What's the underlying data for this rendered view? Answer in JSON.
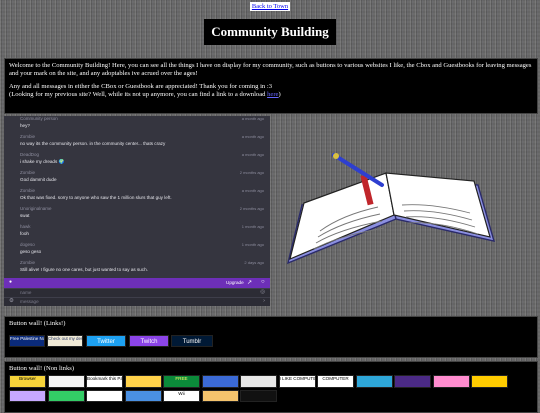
{
  "page": {
    "back_link": "Back to Town",
    "title": "Community Building",
    "welcome_p1": "Welcome to the Community Building! Here, you can see all the things I have on display for my community, such as buttons to various websites I like, the Cbox and Guestbooks for leaving messages and your mark on the site, and any adoptables ive acrued over the ages!",
    "welcome_p2_a": "Any and all messages in either the CBox or Guestbook are appreciated! Thank you for coming in :3",
    "welcome_p2_b": "(Looking for my previous site? Well, while its not up anymore, you can find a link to a download ",
    "welcome_link": "here",
    "welcome_p2_c": ")"
  },
  "chat": {
    "messages": [
      {
        "name": "Community person",
        "time": "a month ago",
        "text": "hey?"
      },
      {
        "name": "Zombie",
        "time": "a month ago",
        "text": "no way its the community person. in the community center... thats crazy"
      },
      {
        "name": "DeadDog",
        "time": "a month ago",
        "text": "i shake my dreads 🌍"
      },
      {
        "name": "Zombie",
        "time": "2 months ago",
        "text": "God dammit dude"
      },
      {
        "name": "Zombie",
        "time": "a month ago",
        "text": "Ok that was fixed. sorry to anyone who saw the 1 million slurs that guy left."
      },
      {
        "name": "Unoriginalname",
        "time": "2 months ago",
        "text": "swat"
      },
      {
        "name": "hawk",
        "time": "1 month ago",
        "text": "fooh"
      },
      {
        "name": "dogeso",
        "time": "1 month ago",
        "text": "geso geso"
      },
      {
        "name": "Zombie",
        "time": "2 days ago",
        "text": "Still alive! I figure no one cares, but just wanted to say as such."
      }
    ],
    "upgrade_label": "Upgrade",
    "name_placeholder": "name",
    "message_placeholder": "message"
  },
  "button_wall_links": {
    "heading": "Button wall! (Links!)",
    "buttons": [
      {
        "label": "Free Palestine Now!!!",
        "bg": "#0a2a7a",
        "fg": "#ffffff"
      },
      {
        "label": "Check out my dev Profile",
        "bg": "#f0ead6",
        "fg": "#203060"
      },
      {
        "label": "Twitter",
        "bg": "#1da1f2",
        "fg": "#ffffff"
      },
      {
        "label": "Twitch",
        "bg": "#8b44e8",
        "fg": "#ffffff"
      },
      {
        "label": "Tumblr",
        "bg": "#001935",
        "fg": "#ffffff"
      }
    ]
  },
  "button_wall_nonlinks": {
    "heading": "Button wall! (Non links)",
    "buttons": [
      {
        "label": "Browser",
        "bg": "#f5d33a",
        "fg": "#000000"
      },
      {
        "label": "",
        "bg": "#f4f4f4",
        "fg": "#000000"
      },
      {
        "label": "Bookmark this Page!",
        "bg": "#ffffff",
        "fg": "#000000"
      },
      {
        "label": "",
        "bg": "#ffd24a",
        "fg": "#000000"
      },
      {
        "label": "FREE",
        "bg": "#0b8a3a",
        "fg": "#ffff66"
      },
      {
        "label": "",
        "bg": "#3b6ad6",
        "fg": "#ffffff"
      },
      {
        "label": "",
        "bg": "#e8e8e8",
        "fg": "#000000"
      },
      {
        "label": "I LIKE COMPUTER",
        "bg": "#ffffff",
        "fg": "#000000"
      },
      {
        "label": "COMPUTER",
        "bg": "#ffffff",
        "fg": "#000000"
      },
      {
        "label": "",
        "bg": "#2ea7d9",
        "fg": "#ffffff"
      },
      {
        "label": "",
        "bg": "#4b2a86",
        "fg": "#ffffff"
      },
      {
        "label": "",
        "bg": "#ff8ccf",
        "fg": "#000000"
      },
      {
        "label": "",
        "bg": "#ffcc00",
        "fg": "#d01818"
      },
      {
        "label": "",
        "bg": "#c6a8ff",
        "fg": "#000000"
      },
      {
        "label": "",
        "bg": "#33cc66",
        "fg": "#000000"
      },
      {
        "label": "",
        "bg": "#ffffff",
        "fg": "#000000"
      },
      {
        "label": "",
        "bg": "#4a90e2",
        "fg": "#ffffff"
      },
      {
        "label": "Wii",
        "bg": "#ffffff",
        "fg": "#000000"
      },
      {
        "label": "",
        "bg": "#f5c46d",
        "fg": "#000000"
      },
      {
        "label": "",
        "bg": "#111111",
        "fg": "#ffffff"
      }
    ]
  }
}
